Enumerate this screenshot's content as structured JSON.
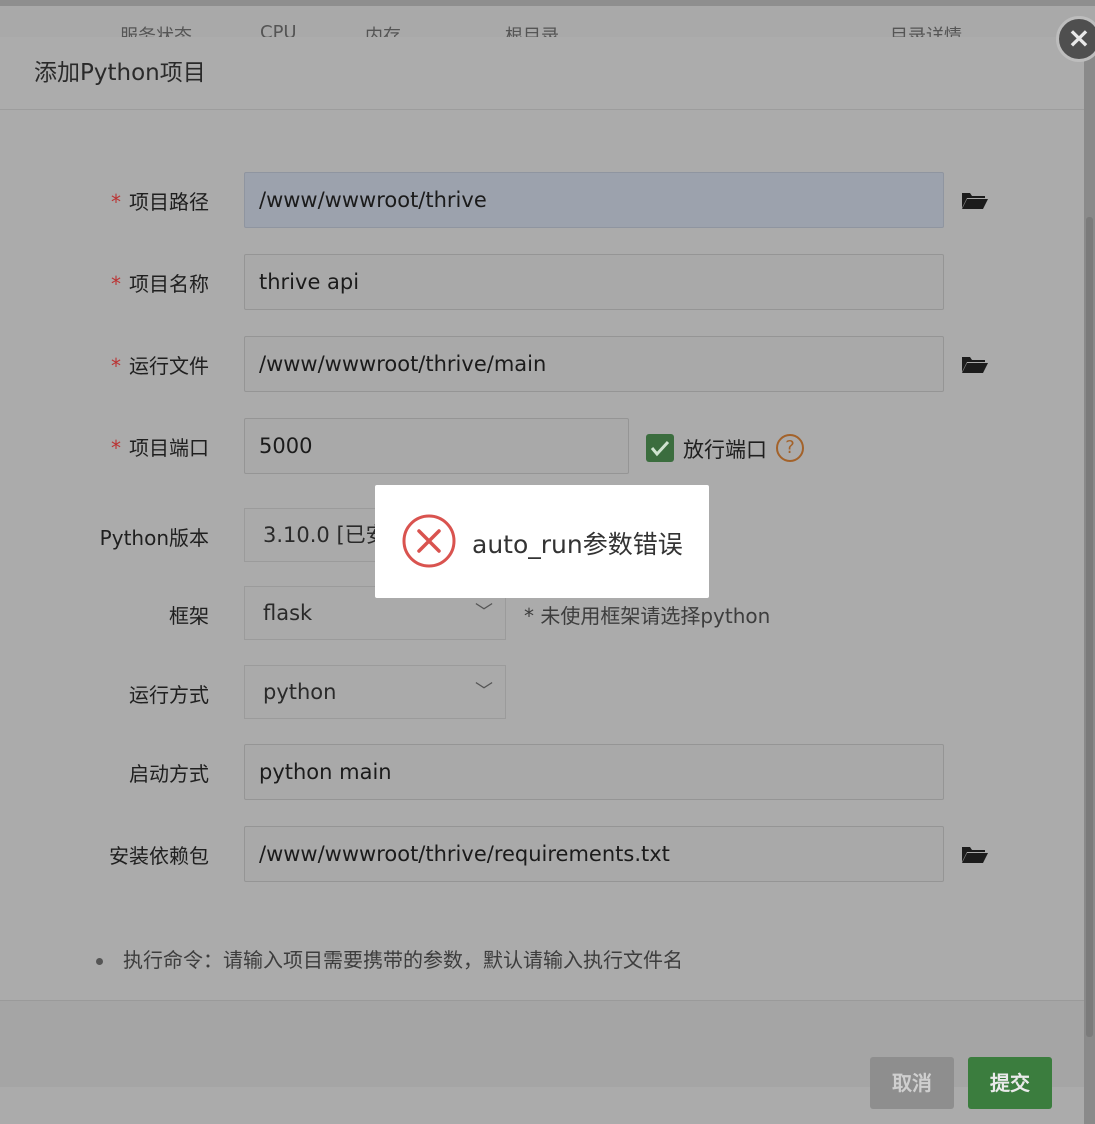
{
  "background_table": {
    "headers": [
      "服务状态",
      "CPU",
      "内存",
      "根目录",
      "目录详情"
    ]
  },
  "dialog": {
    "title": "添加Python项目",
    "close_symbol": "×"
  },
  "form": {
    "required_mark": "*",
    "project_path": {
      "label": "项目路径",
      "value": "/www/wwwroot/thrive"
    },
    "project_name": {
      "label": "项目名称",
      "value": "thrive api"
    },
    "run_file": {
      "label": "运行文件",
      "value": "/www/wwwroot/thrive/main"
    },
    "project_port": {
      "label": "项目端口",
      "value": "5000",
      "open_port_label": "放行端口",
      "open_port_checked": true,
      "help_symbol": "?"
    },
    "python_version": {
      "label": "Python版本",
      "value": "3.10.0 [已安"
    },
    "framework": {
      "label": "框架",
      "value": "flask",
      "hint": "* 未使用框架请选择python"
    },
    "run_mode": {
      "label": "运行方式",
      "value": "python"
    },
    "start_mode": {
      "label": "启动方式",
      "value": "python main"
    },
    "install_deps": {
      "label": "安装依赖包",
      "value": "/www/wwwroot/thrive/requirements.txt"
    }
  },
  "note": "执行命令：请输入项目需要携带的参数，默认请输入执行文件名",
  "buttons": {
    "cancel": "取消",
    "submit": "提交"
  },
  "toast": {
    "message": "auto_run参数错误"
  },
  "colors": {
    "submit": "#3b7d3e",
    "checkbox": "#3b6d3e",
    "error": "#d9534f",
    "help": "#a3622a"
  }
}
